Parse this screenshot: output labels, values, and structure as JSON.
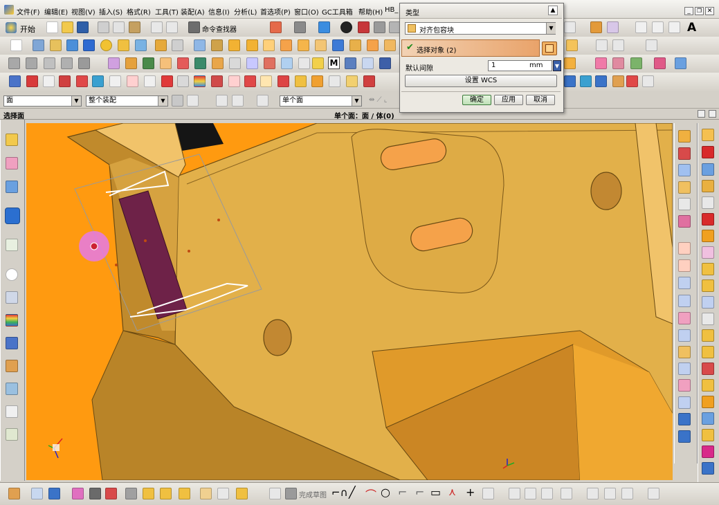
{
  "menu": {
    "items": [
      "文件(F)",
      "编辑(E)",
      "视图(V)",
      "插入(S)",
      "格式(R)",
      "工具(T)",
      "装配(A)",
      "信息(I)",
      "分析(L)",
      "首选项(P)",
      "窗口(O)",
      "GC工具箱",
      "帮助(H)",
      "HB_"
    ]
  },
  "toolbar": {
    "start_label": "开始",
    "command_finder_label": "命令查找器"
  },
  "selection_bar": {
    "filter_value": "面",
    "scope_value": "整个装配",
    "face_rule_value": "单个面"
  },
  "status": {
    "prompt": "选择面",
    "selection_info": "单个面：面 / 体(0)"
  },
  "dialog": {
    "section_title": "类型",
    "type_value": "对齐包容块",
    "select_object_label": "选择对象 (2)",
    "offset_label": "默认间隙",
    "offset_value": "1",
    "offset_unit": "mm",
    "set_wcs_label": "设置 WCS",
    "ok_label": "确定",
    "apply_label": "应用",
    "cancel_label": "取消"
  },
  "bottom_toolbar": {
    "finish_sketch_label": "完成草图"
  },
  "colors": {
    "viewport_bg": "#ff9a10",
    "part_body": "#e2b04a",
    "selected_face": "#6e2248",
    "accent_orange": "#f5a24a"
  }
}
